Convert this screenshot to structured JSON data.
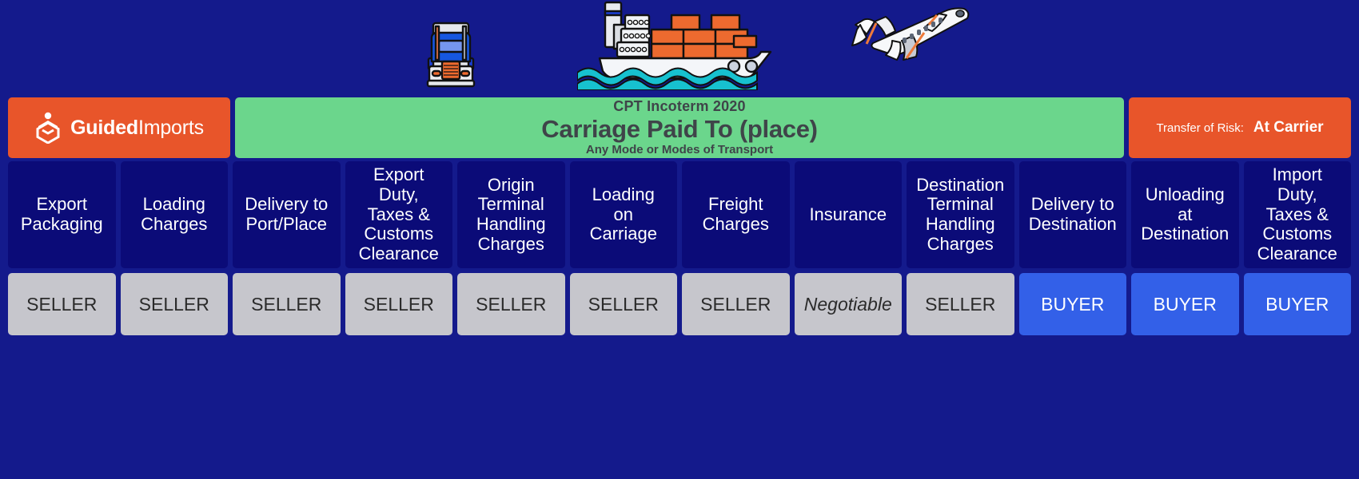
{
  "brand": {
    "logo_icon": "guided-imports-logo-icon",
    "name_bold": "Guided",
    "name_light": "Imports"
  },
  "header": {
    "eyebrow": "CPT Incoterm 2020",
    "title": "Carriage Paid To (place)",
    "subtitle": "Any Mode or Modes of Transport",
    "risk_label": "Transfer of Risk:",
    "risk_value": "At Carrier"
  },
  "transport_icons": [
    {
      "name": "truck-icon",
      "label": "Truck"
    },
    {
      "name": "cargo-ship-icon",
      "label": "Container Ship"
    },
    {
      "name": "airplane-icon",
      "label": "Airplane"
    }
  ],
  "colors": {
    "background": "#141a8c",
    "brand_orange": "#e8552a",
    "title_green": "#6bd68c",
    "category_navy": "#0b0b78",
    "seller_gray": "#c6c6cc",
    "buyer_blue": "#3360e8"
  },
  "chart_data": {
    "type": "table",
    "title": "Carriage Paid To (place)",
    "subtitle": "Any Mode or Modes of Transport",
    "incoterm": "CPT Incoterm 2020",
    "transfer_of_risk": "At Carrier",
    "columns": [
      "Export Packaging",
      "Loading Charges",
      "Delivery to Port/Place",
      "Export Duty, Taxes & Customs Clearance",
      "Origin Terminal Handling Charges",
      "Loading on Carriage",
      "Freight Charges",
      "Insurance",
      "Destination Terminal Handling Charges",
      "Delivery to Destination",
      "Unloading at Destination",
      "Import Duty, Taxes & Customs Clearance"
    ],
    "values": [
      "SELLER",
      "SELLER",
      "SELLER",
      "SELLER",
      "SELLER",
      "SELLER",
      "SELLER",
      "Negotiable",
      "SELLER",
      "BUYER",
      "BUYER",
      "BUYER"
    ]
  },
  "categories": [
    {
      "lines": [
        "Export",
        "Packaging"
      ],
      "responsibility": "SELLER",
      "kind": "seller"
    },
    {
      "lines": [
        "Loading",
        "Charges"
      ],
      "responsibility": "SELLER",
      "kind": "seller"
    },
    {
      "lines": [
        "Delivery to",
        "Port/Place"
      ],
      "responsibility": "SELLER",
      "kind": "seller"
    },
    {
      "lines": [
        "Export",
        "Duty,",
        "Taxes &",
        "Customs",
        "Clearance"
      ],
      "responsibility": "SELLER",
      "kind": "seller"
    },
    {
      "lines": [
        "Origin",
        "Terminal",
        "Handling",
        "Charges"
      ],
      "responsibility": "SELLER",
      "kind": "seller"
    },
    {
      "lines": [
        "Loading",
        "on",
        "Carriage"
      ],
      "responsibility": "SELLER",
      "kind": "seller"
    },
    {
      "lines": [
        "Freight",
        "Charges"
      ],
      "responsibility": "SELLER",
      "kind": "seller"
    },
    {
      "lines": [
        "Insurance"
      ],
      "responsibility": "Negotiable",
      "kind": "negotiable"
    },
    {
      "lines": [
        "Destination",
        "Terminal",
        "Handling",
        "Charges"
      ],
      "responsibility": "SELLER",
      "kind": "seller"
    },
    {
      "lines": [
        "Delivery to",
        "Destination"
      ],
      "responsibility": "BUYER",
      "kind": "buyer"
    },
    {
      "lines": [
        "Unloading",
        "at",
        "Destination"
      ],
      "responsibility": "BUYER",
      "kind": "buyer"
    },
    {
      "lines": [
        "Import",
        "Duty,",
        "Taxes &",
        "Customs",
        "Clearance"
      ],
      "responsibility": "BUYER",
      "kind": "buyer"
    }
  ]
}
